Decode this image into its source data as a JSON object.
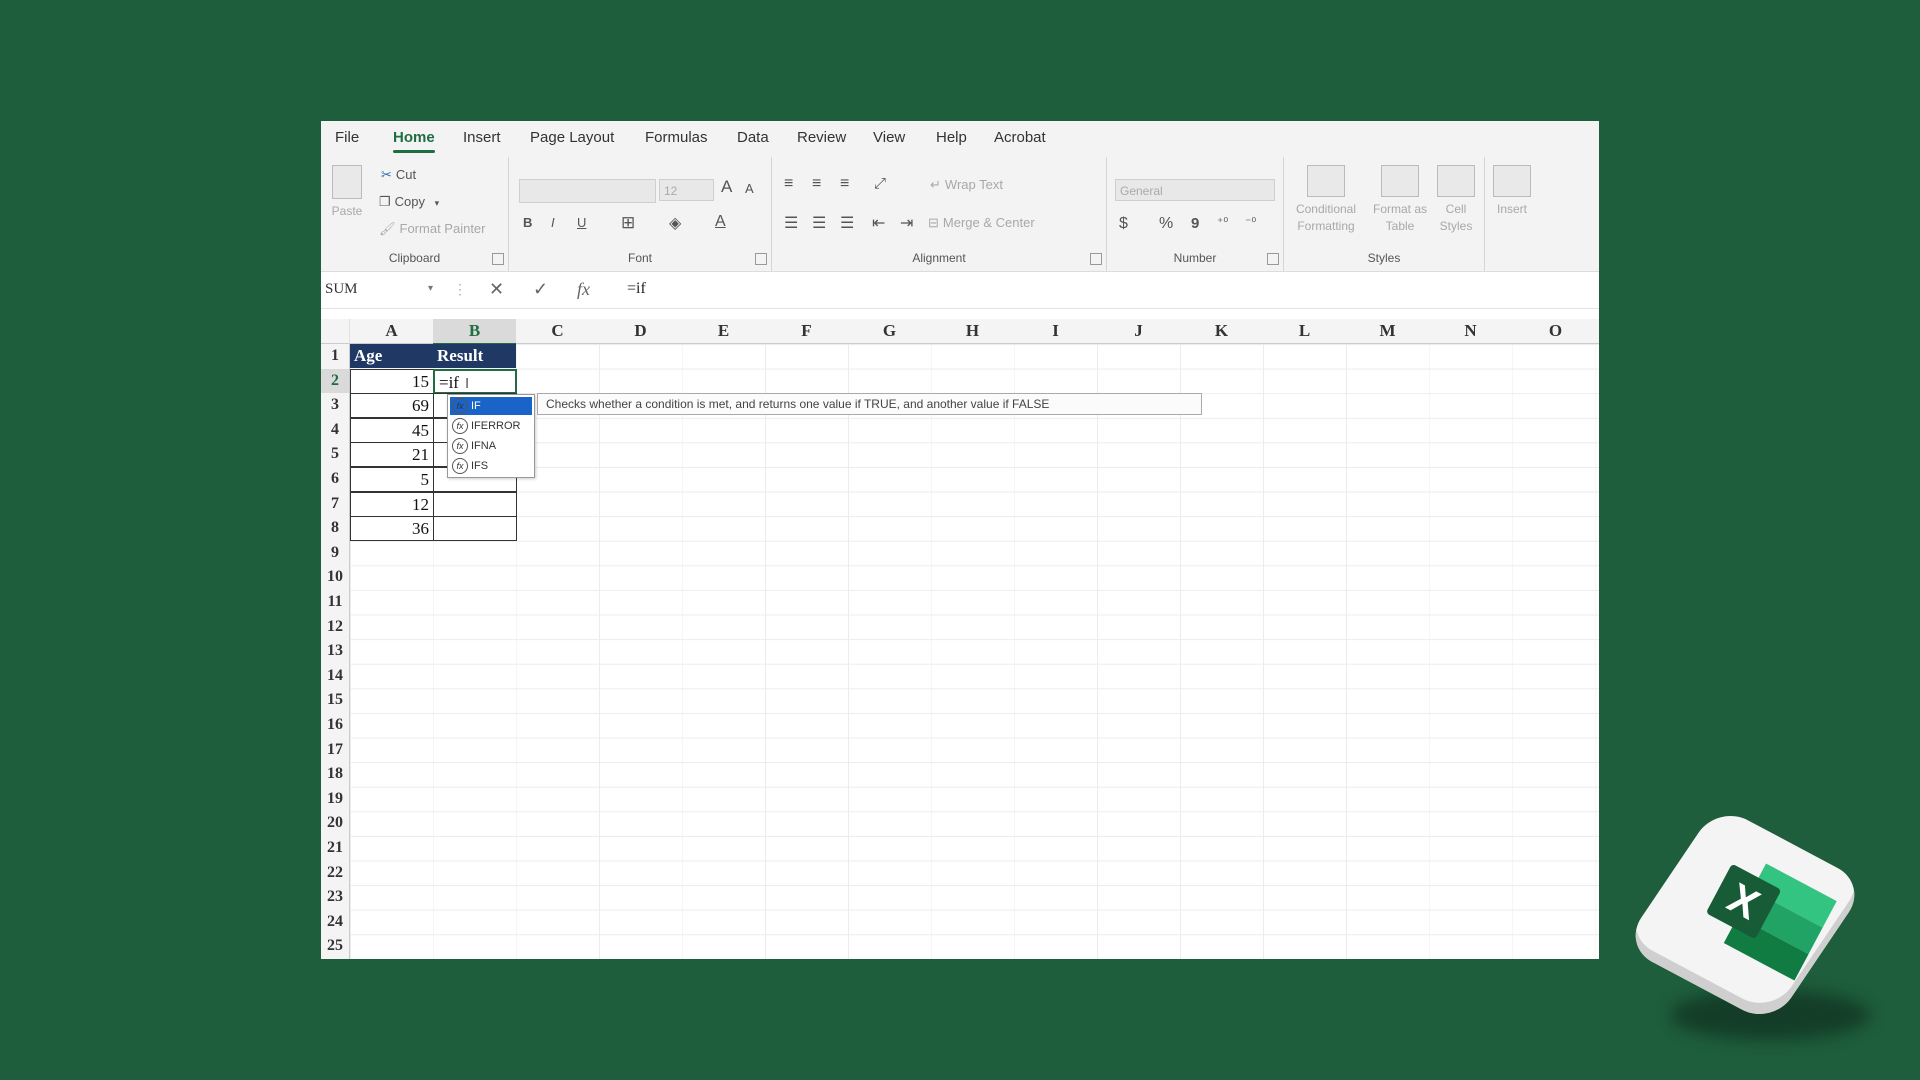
{
  "menu": {
    "items": [
      "File",
      "Home",
      "Insert",
      "Page Layout",
      "Formulas",
      "Data",
      "Review",
      "View",
      "Help",
      "Acrobat"
    ],
    "active": "Home"
  },
  "ribbon": {
    "clipboard": {
      "paste": "Paste",
      "cut": "Cut",
      "copy": "Copy",
      "format_painter": "Format Painter",
      "label": "Clipboard"
    },
    "font": {
      "size": "12",
      "bold": "B",
      "italic": "I",
      "underline": "U",
      "grow": "A",
      "shrink": "A",
      "label": "Font"
    },
    "alignment": {
      "wrap_text": "Wrap Text",
      "merge_center": "Merge & Center",
      "label": "Alignment"
    },
    "number": {
      "format": "General",
      "currency": "$",
      "percent": "%",
      "comma": "9",
      "label": "Number"
    },
    "styles": {
      "conditional": "Conditional Formatting",
      "format_table": "Format as Table",
      "cell_styles": "Cell Styles",
      "label": "Styles"
    },
    "cells": {
      "insert": "Insert"
    }
  },
  "formula_bar": {
    "name_box": "SUM",
    "cancel": "✕",
    "enter": "✓",
    "fx": "fx",
    "formula": "=if"
  },
  "columns": [
    "A",
    "B",
    "C",
    "D",
    "E",
    "F",
    "G",
    "H",
    "I",
    "J",
    "K",
    "L",
    "M",
    "N",
    "O"
  ],
  "rows": [
    "1",
    "2",
    "3",
    "4",
    "5",
    "6",
    "7",
    "8",
    "9",
    "10",
    "11",
    "12",
    "13",
    "14",
    "15",
    "16",
    "17",
    "18",
    "19",
    "20",
    "21",
    "22",
    "23",
    "24",
    "25"
  ],
  "table": {
    "headers": [
      "Age",
      "Result"
    ],
    "ages": [
      "15",
      "69",
      "45",
      "21",
      "5",
      "12",
      "36"
    ],
    "editing_cell": "=if"
  },
  "autocomplete": {
    "items": [
      "IF",
      "IFERROR",
      "IFNA",
      "IFS"
    ],
    "selected": "IF",
    "tooltip": "Checks whether a condition is met, and returns one value if TRUE, and another value if FALSE"
  },
  "logo": {
    "letter": "X",
    "colors": {
      "dark": "#185c37",
      "mid": "#21a366",
      "light": "#33c481"
    }
  }
}
